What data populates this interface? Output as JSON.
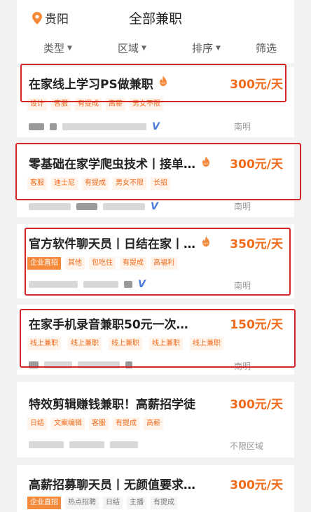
{
  "header": {
    "city": "贵阳",
    "title": "全部兼职",
    "filters": [
      "类型",
      "区域",
      "排序",
      "筛选"
    ]
  },
  "jobs": [
    {
      "title": "在家线上学习PS做兼职",
      "salary": "300元/天",
      "tags": [
        "设计",
        "客服",
        "有提成",
        "高薪",
        "男女不限"
      ],
      "district": "南明",
      "hot": true
    },
    {
      "title": "零基础在家学爬虫技术丨接单…",
      "salary": "300元/天",
      "tags": [
        "客服",
        "迪士尼",
        "有提成",
        "男女不限",
        "长招"
      ],
      "district": "南明",
      "hot": true
    },
    {
      "title": "官方软件聊天员丨日结在家丨…",
      "salary": "350元/天",
      "tags": [
        "企业直招",
        "其他",
        "包吃住",
        "有提成",
        "高福利"
      ],
      "district": "南明",
      "hot": true
    },
    {
      "title": "在家手机录音兼职50元一次…",
      "salary": "150元/天",
      "tags": [
        "线上兼职",
        "线上兼职",
        "线上兼职",
        "线上兼职",
        "线上兼职"
      ],
      "district": "南明",
      "hot": false
    },
    {
      "title": "特效剪辑赚钱兼职！高薪招学徒",
      "salary": "300元/天",
      "tags": [
        "日结",
        "文案编辑",
        "客服",
        "有提成",
        "高薪"
      ],
      "district": "不限区域",
      "hot": false
    },
    {
      "title": "高薪招募聊天员丨无颜值要求…",
      "salary": "300元/天",
      "tags": [
        "企业直招",
        "热点招聘",
        "日结",
        "主播",
        "有提成"
      ],
      "district": "",
      "hot": false
    }
  ],
  "colors": {
    "accent": "#f06a1a",
    "highlight_box": "#d32626",
    "verified_icon": "#4a7bd8"
  }
}
